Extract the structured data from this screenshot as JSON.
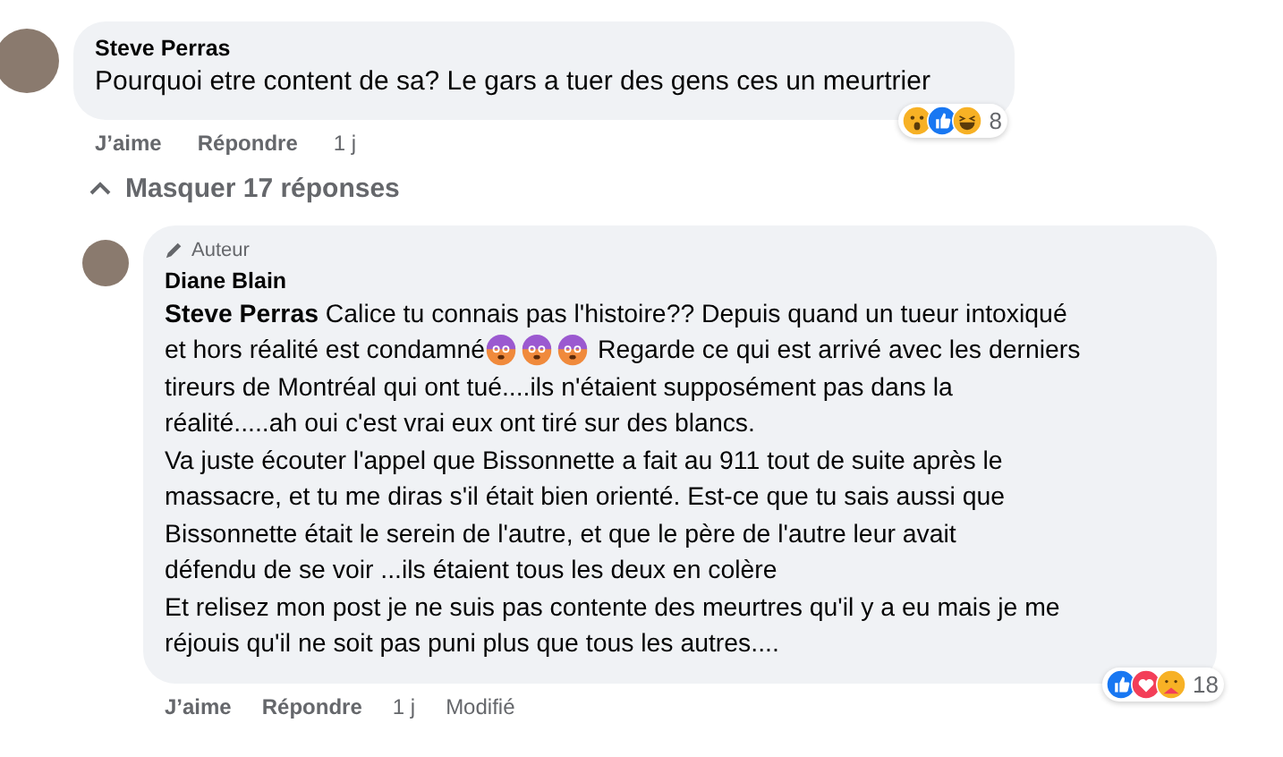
{
  "comments": [
    {
      "author": "Steve Perras",
      "lines": [
        [
          {
            "kind": "text",
            "text": "Pourquoi etre content de sa? Le gars a tuer des gens ces un meurtrier"
          }
        ]
      ],
      "actions": {
        "like": "J’aime",
        "reply": "Répondre",
        "time": "1 j"
      },
      "reactions": [
        {
          "kind": "wow"
        },
        {
          "kind": "like"
        },
        {
          "kind": "haha"
        }
      ],
      "reaction_count": "8",
      "replies_toggle": {
        "label": "Masquer 17 réponses",
        "expanded": true
      }
    },
    {
      "author": "Diane Blain",
      "author_badge": "Auteur",
      "lines": [
        [
          {
            "kind": "text",
            "text": "**Steve Perras** Calice tu connais pas l'histoire?? Depuis quand un tueur intoxiqué"
          }
        ],
        [
          {
            "kind": "text",
            "text": "et hors réalité est condamné"
          },
          {
            "kind": "emoji"
          },
          {
            "kind": "emoji"
          },
          {
            "kind": "emoji"
          },
          {
            "kind": "text",
            "text": "Regarde ce qui est arrivé avec les derniers"
          }
        ],
        [
          {
            "kind": "text",
            "text": "tireurs de Montréal qui ont tué....ils n'étaient supposément pas dans la"
          }
        ],
        [
          {
            "kind": "text",
            "text": "réalité.....ah oui c'est vrai eux ont tiré sur des blancs."
          }
        ],
        [
          {
            "kind": "text",
            "text": "Va juste écouter l'appel que Bissonnette a fait au 911 tout de suite après le"
          }
        ],
        [
          {
            "kind": "text",
            "text": "massacre, et tu me diras s'il était bien orienté. Est-ce que tu sais aussi que"
          }
        ],
        [
          {
            "kind": "text",
            "text": "Bissonnette était le serein de l'autre, et que le père de l'autre leur avait"
          }
        ],
        [
          {
            "kind": "text",
            "text": "défendu de se voir ...ils étaient tous les deux en colère"
          }
        ],
        [
          {
            "kind": "text",
            "text": "Et relisez mon post je ne suis pas contente des meurtres qu'il y a eu mais je me"
          }
        ],
        [
          {
            "kind": "text",
            "text": "réjouis qu'il ne soit pas puni plus que tous les autres...."
          }
        ]
      ],
      "actions": {
        "like": "J’aime",
        "reply": "Répondre",
        "time": "1 j",
        "edited": "Modifié"
      },
      "reactions": [
        {
          "kind": "like"
        },
        {
          "kind": "love"
        },
        {
          "kind": "care"
        }
      ],
      "reaction_count": "18"
    }
  ]
}
